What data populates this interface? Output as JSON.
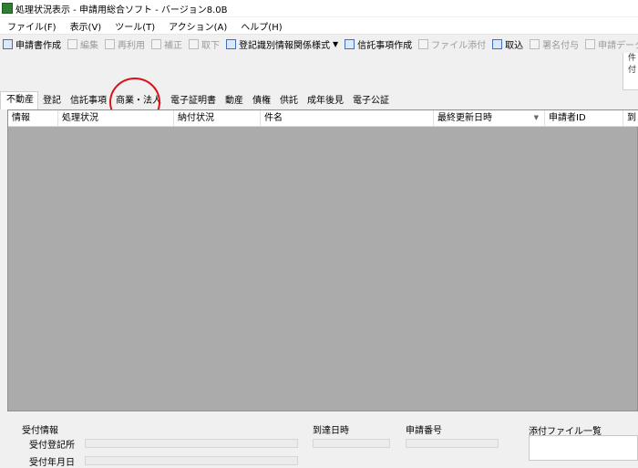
{
  "window": {
    "title": "処理状況表示 - 申請用総合ソフト - バージョン8.0B"
  },
  "menu": [
    "ファイル(F)",
    "表示(V)",
    "ツール(T)",
    "アクション(A)",
    "ヘルプ(H)"
  ],
  "toolbar": {
    "create": "申請書作成",
    "edit": "編集",
    "reuse": "再利用",
    "amend": "補正",
    "withdraw": "取下",
    "form": "登記識別情報関係様式",
    "trust": "信託事項作成",
    "attach": "ファイル添付",
    "fetch": "取込",
    "sign": "署名付与",
    "send": "申請データ送信"
  },
  "right_panel": {
    "line1": "件",
    "line2": "付"
  },
  "tabs": [
    "不動産",
    "登記",
    "信託事項",
    "商業・法人",
    "電子証明書",
    "動産",
    "債権",
    "供託",
    "成年後見",
    "電子公証"
  ],
  "grid": {
    "columns": [
      "情報",
      "処理状況",
      "納付状況",
      "件名",
      "最終更新日時",
      "申請者ID",
      "到"
    ]
  },
  "details": {
    "receipt_group": "受付情報",
    "receipt_office": "受付登記所",
    "receipt_date": "受付年月日",
    "arrival": "到達日時",
    "app_number": "申請番号",
    "attachments": "添付ファイル一覧"
  },
  "colors": {
    "highlight": "#d8141a",
    "grid_bg": "#ababab"
  }
}
